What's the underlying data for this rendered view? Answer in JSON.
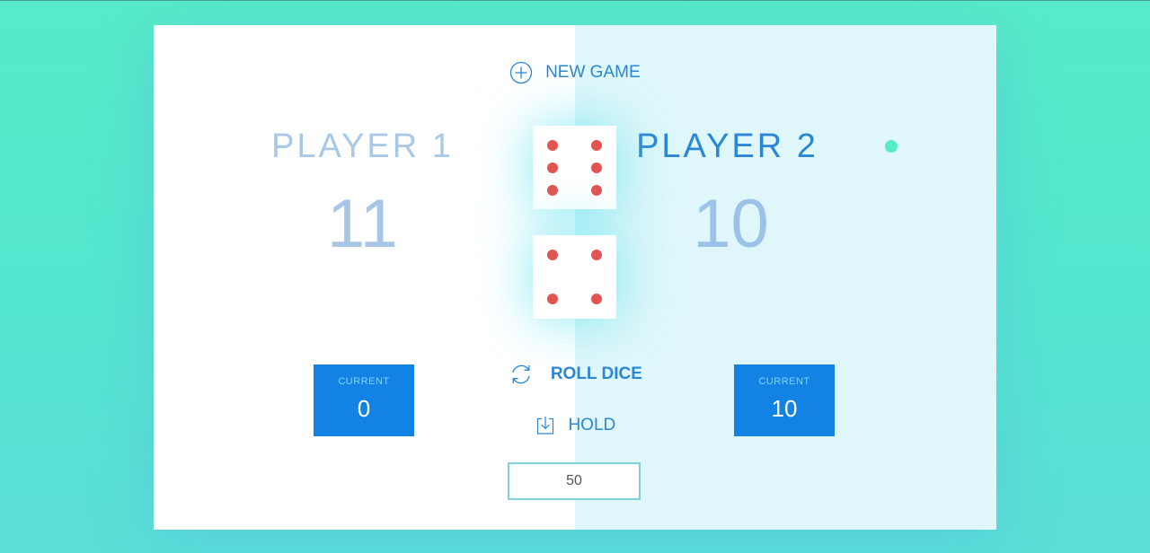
{
  "game": {
    "new_game_label": "NEW GAME",
    "roll_dice_label": "ROLL DICE",
    "hold_label": "HOLD",
    "final_score_value": "50",
    "dice": [
      6,
      4
    ],
    "active_player": 2
  },
  "players": [
    {
      "name": "PLAYER 1",
      "score": "11",
      "current_label": "CURRENT",
      "current_score": "0"
    },
    {
      "name": "PLAYER 2",
      "score": "10",
      "current_label": "CURRENT",
      "current_score": "10"
    }
  ],
  "colors": {
    "background": "#57ebc9",
    "accent_blue": "#1382e5",
    "active_panel": "#dff7fa",
    "active_dot": "#57ebc9",
    "dice_pip": "#e25451"
  },
  "icons": {
    "new_game": "plus-circle-icon",
    "roll_dice": "refresh-icon",
    "hold": "download-icon",
    "active_player": "active-dot-icon"
  }
}
